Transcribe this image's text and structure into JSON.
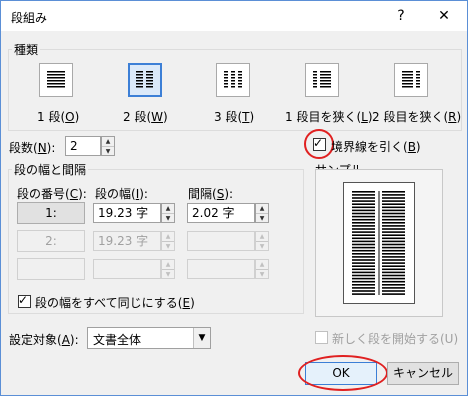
{
  "dialog": {
    "title": "段組み"
  },
  "titlebar": {
    "help_label": "?",
    "close_label": "✕"
  },
  "type_group": {
    "label": "種類",
    "presets": [
      {
        "label_pre": "1 段(",
        "key": "O",
        "label_post": ")",
        "icon": "one-column-icon"
      },
      {
        "label_pre": "2 段(",
        "key": "W",
        "label_post": ")",
        "icon": "two-columns-icon",
        "selected": true
      },
      {
        "label_pre": "3 段(",
        "key": "T",
        "label_post": ")",
        "icon": "three-columns-icon"
      },
      {
        "label_pre": "1 段目を狭く(",
        "key": "L",
        "label_post": ")",
        "icon": "left-narrow-icon"
      },
      {
        "label_pre": "2 段目を狭く(",
        "key": "R",
        "label_post": ")",
        "icon": "right-narrow-icon"
      }
    ]
  },
  "columns": {
    "label_pre": "段数(",
    "key": "N",
    "label_post": "):",
    "value": "2"
  },
  "divider": {
    "label_pre": "境界線を引く(",
    "key": "B",
    "label_post": ")",
    "checked": true
  },
  "width_group": {
    "label": "段の幅と間隔",
    "col_header": {
      "pre": "段の番号(",
      "key": "C",
      "post": "):"
    },
    "width_header": {
      "pre": "段の幅(",
      "key": "I",
      "post": "):"
    },
    "spacing_header": {
      "pre": "間隔(",
      "key": "S",
      "post": "):"
    },
    "rows": [
      {
        "number": "1:",
        "width": "19.23 字",
        "spacing": "2.02 字",
        "enabled": true
      },
      {
        "number": "2:",
        "width": "19.23 字",
        "spacing": "",
        "enabled": false
      },
      {
        "number": "",
        "width": "",
        "spacing": "",
        "enabled": false
      }
    ],
    "equal_width": {
      "label_pre": "段の幅をすべて同じにする(",
      "key": "E",
      "label_post": ")",
      "checked": true
    }
  },
  "preview": {
    "label": "サンプル"
  },
  "apply_to": {
    "label_pre": "設定対象(",
    "key": "A",
    "label_post": "):",
    "value": "文書全体"
  },
  "new_column": {
    "label": "新しく段を開始する(U)",
    "checked": false,
    "enabled": false
  },
  "buttons": {
    "ok": "OK",
    "cancel": "キャンセル"
  },
  "colors": {
    "accent": "#3c7fd6",
    "highlight_ring": "#e02020"
  }
}
